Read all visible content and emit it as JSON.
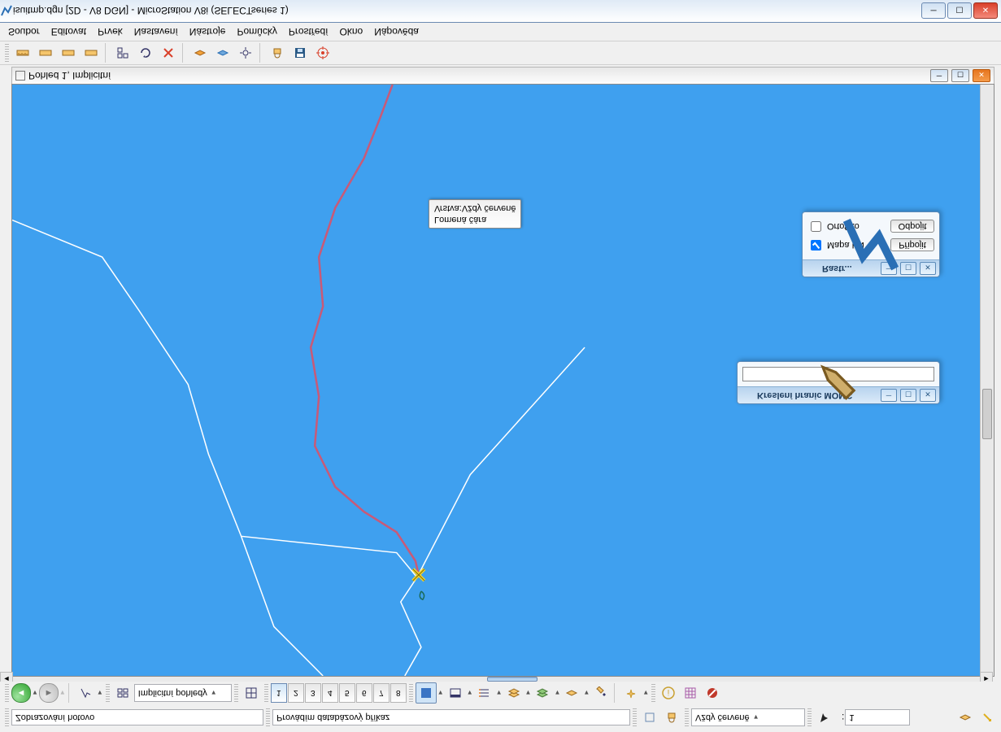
{
  "app": {
    "title": "isuitmp.dgn [2D - V8 DGN] - MicroStation V8i (SELECTseries 1)"
  },
  "menu": {
    "items": [
      "Soubor",
      "Editovat",
      "Prvek",
      "Nastavení",
      "Nástroje",
      "Pomůcky",
      "Prostředí",
      "Okno",
      "Nápověda"
    ]
  },
  "view": {
    "title": "Pohled 1, Implicitní"
  },
  "tooltip": {
    "line1": "Lomená čára",
    "line2": "Vrstva:Vždy červeně"
  },
  "float_rastr": {
    "title": "Rastr...",
    "chk_mapa": "Mapa KN",
    "chk_ortofoto": "Ortofoto",
    "btn_pripojit": "Připojit",
    "btn_odpojit": "Odpojit",
    "mapa_checked": true,
    "ortofoto_checked": false
  },
  "float_kresleni": {
    "title": "Kreslení hranic MOMC",
    "value": ""
  },
  "status": {
    "left": "Zobrazování hotovo",
    "center": "Provádím databázový příkaz",
    "layer": "Vždy červeně",
    "right_num": "1"
  },
  "toolbar_top": {
    "views_label": "Implicitní pohledy",
    "view_numbers": [
      "1",
      "2",
      "3",
      "4",
      "5",
      "6",
      "7",
      "8"
    ]
  },
  "colors": {
    "canvas_bg": "#3fa0ef",
    "route": "#c85a78",
    "border_white": "#ffffff"
  }
}
